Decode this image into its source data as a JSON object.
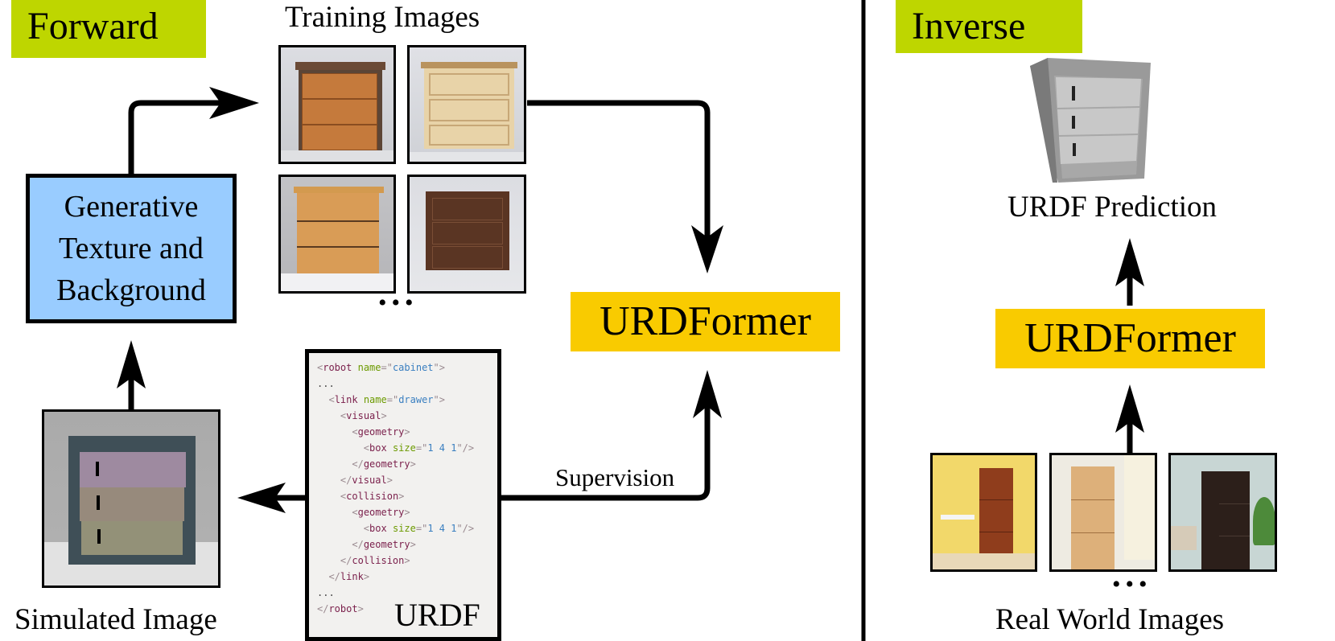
{
  "forward": {
    "label": "Forward",
    "label_color": "#bed600",
    "training_images_caption": "Training Images",
    "training_images": [
      {
        "name": "training-image-1",
        "description": "orange wooden cabinet with three drawers"
      },
      {
        "name": "training-image-2",
        "description": "light wooden cabinet with three drawers"
      },
      {
        "name": "training-image-3",
        "description": "honey oak cabinet with three drawers"
      },
      {
        "name": "training-image-4",
        "description": "dark brown cabinet with three drawers"
      }
    ],
    "ellipsis": "•••",
    "generative_box": {
      "lines": [
        "Generative",
        "Texture and",
        "Background"
      ],
      "color": "#99ccff"
    },
    "model_label": "URDFormer",
    "model_color": "#f9cb00",
    "simulated_caption": "Simulated Image",
    "supervision_label": "Supervision",
    "urdf_label": "URDF",
    "urdf_code": [
      "<robot name=\"cabinet\">",
      "...",
      "  <link name=\"drawer\">",
      "    <visual>",
      "      <geometry>",
      "        <box size=\"1 4 1\"/>",
      "      </geometry>",
      "    </visual>",
      "    <collision>",
      "      <geometry>",
      "        <box size=\"1 4 1\"/>",
      "      </geometry>",
      "    </collision>",
      "  </link>",
      "...",
      "</robot>"
    ]
  },
  "inverse": {
    "label": "Inverse",
    "prediction_caption": "URDF Prediction",
    "model_label": "URDFormer",
    "real_images_caption": "Real World Images",
    "ellipsis": "•••",
    "real_images": [
      {
        "name": "real-image-1",
        "description": "red-brown cabinet beside yellow wall and side table"
      },
      {
        "name": "real-image-2",
        "description": "light wood cabinet in white room"
      },
      {
        "name": "real-image-3",
        "description": "dark brown cabinet with plant"
      }
    ]
  }
}
